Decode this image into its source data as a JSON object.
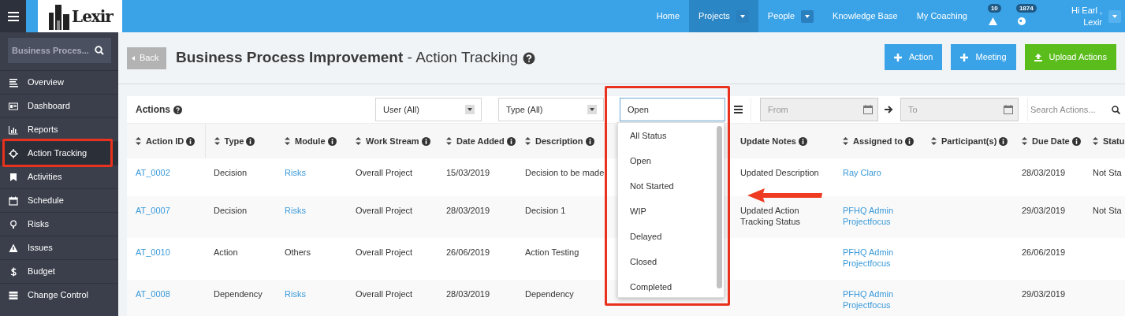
{
  "header": {
    "logo": "Lexir",
    "nav": [
      {
        "label": "Home",
        "selected": false,
        "dropdown": false
      },
      {
        "label": "Projects",
        "selected": true,
        "dropdown": true
      },
      {
        "label": "People",
        "selected": false,
        "dropdown": true
      },
      {
        "label": "Knowledge Base",
        "selected": false,
        "dropdown": false
      },
      {
        "label": "My Coaching",
        "selected": false,
        "dropdown": false
      }
    ],
    "alerts": [
      {
        "kind": "warning",
        "count": "10"
      },
      {
        "kind": "globe",
        "count": "1874"
      }
    ],
    "user": {
      "greeting": "Hi Earl ,",
      "org": "Lexir"
    }
  },
  "sidebar": {
    "search": {
      "value": "Business Proces..."
    },
    "items": [
      {
        "label": "Overview",
        "selected": false
      },
      {
        "label": "Dashboard",
        "selected": false
      },
      {
        "label": "Reports",
        "selected": false
      },
      {
        "label": "Action Tracking",
        "selected": true
      },
      {
        "label": "Activities",
        "selected": false
      },
      {
        "label": "Schedule",
        "selected": false
      },
      {
        "label": "Risks",
        "selected": false
      },
      {
        "label": "Issues",
        "selected": false
      },
      {
        "label": "Budget",
        "selected": false
      },
      {
        "label": "Change Control",
        "selected": false
      }
    ]
  },
  "page": {
    "back": "Back",
    "title": "Business Process Improvement",
    "subtitle": " - Action Tracking",
    "buttons": [
      {
        "label": "Action",
        "kind": "add"
      },
      {
        "label": "Meeting",
        "kind": "add"
      },
      {
        "label": "Upload Actions",
        "kind": "upload"
      }
    ]
  },
  "panel": {
    "title": "Actions",
    "filters": {
      "user": "User (All)",
      "type": "Type (All)",
      "status": "Open",
      "from_placeholder": "From",
      "to_placeholder": "To",
      "search_placeholder": "Search Actions..."
    },
    "status_options": [
      {
        "label": "All Status",
        "selected": false
      },
      {
        "label": "Open",
        "selected": false
      },
      {
        "label": "Not Started",
        "selected": false
      },
      {
        "label": "WIP",
        "selected": false
      },
      {
        "label": "Delayed",
        "selected": false
      },
      {
        "label": "Closed",
        "selected": false
      },
      {
        "label": "Completed",
        "selected": false
      }
    ],
    "table": {
      "columns": [
        {
          "label": "Action ID",
          "sortable": true
        },
        {
          "label": "Type",
          "sortable": true
        },
        {
          "label": "Module",
          "sortable": true
        },
        {
          "label": "Work Stream",
          "sortable": true
        },
        {
          "label": "Date Added",
          "sortable": true
        },
        {
          "label": "Description",
          "sortable": true
        },
        {
          "label": "Update Notes",
          "sortable": false
        },
        {
          "label": "Assigned to",
          "sortable": true
        },
        {
          "label": "Participant(s)",
          "sortable": true
        },
        {
          "label": "Due Date",
          "sortable": true
        },
        {
          "label": "Statu",
          "sortable": true
        }
      ],
      "rows": [
        {
          "cells": [
            {
              "text": "AT_0002",
              "link": true
            },
            {
              "text": "Decision",
              "link": false
            },
            {
              "text": "Risks",
              "link": true
            },
            {
              "text": "Overall Project",
              "link": false
            },
            {
              "text": "15/03/2019",
              "link": false
            },
            {
              "text": "Decision to be made",
              "link": false
            },
            {
              "text": "Updated Description",
              "link": false
            },
            {
              "text": "Ray Claro",
              "link": true
            },
            null,
            {
              "text": "28/03/2019",
              "link": false
            },
            {
              "text": "Not Sta",
              "link": false
            }
          ]
        },
        {
          "cells": [
            {
              "text": "AT_0007",
              "link": true
            },
            {
              "text": "Decision",
              "link": false
            },
            {
              "text": "Risks",
              "link": true
            },
            {
              "text": "Overall Project",
              "link": false
            },
            {
              "text": "28/03/2019",
              "link": false
            },
            {
              "text": "Decision 1",
              "link": false
            },
            {
              "text": "Updated Action Tracking Status",
              "link": false
            },
            {
              "text": "PFHQ Admin Projectfocus",
              "link": true
            },
            null,
            {
              "text": "29/03/2019",
              "link": false
            },
            {
              "text": "Not Sta",
              "link": false
            }
          ]
        },
        {
          "cells": [
            {
              "text": "AT_0010",
              "link": true
            },
            {
              "text": "Action",
              "link": false
            },
            {
              "text": "Others",
              "link": false
            },
            {
              "text": "Overall Project",
              "link": false
            },
            {
              "text": "26/06/2019",
              "link": false
            },
            {
              "text": "Action Testing",
              "link": false
            },
            null,
            {
              "text": "PFHQ Admin Projectfocus",
              "link": true
            },
            null,
            {
              "text": "26/06/2019",
              "link": false
            },
            null
          ]
        },
        {
          "cells": [
            {
              "text": "AT_0008",
              "link": true
            },
            {
              "text": "Dependency",
              "link": false
            },
            {
              "text": "Risks",
              "link": true
            },
            {
              "text": "Overall Project",
              "link": false
            },
            {
              "text": "28/03/2019",
              "link": false
            },
            {
              "text": "Dependency",
              "link": false
            },
            null,
            {
              "text": "PFHQ Admin Projectfocus",
              "link": true
            },
            null,
            {
              "text": "29/03/2019",
              "link": false
            },
            null
          ]
        }
      ]
    }
  }
}
